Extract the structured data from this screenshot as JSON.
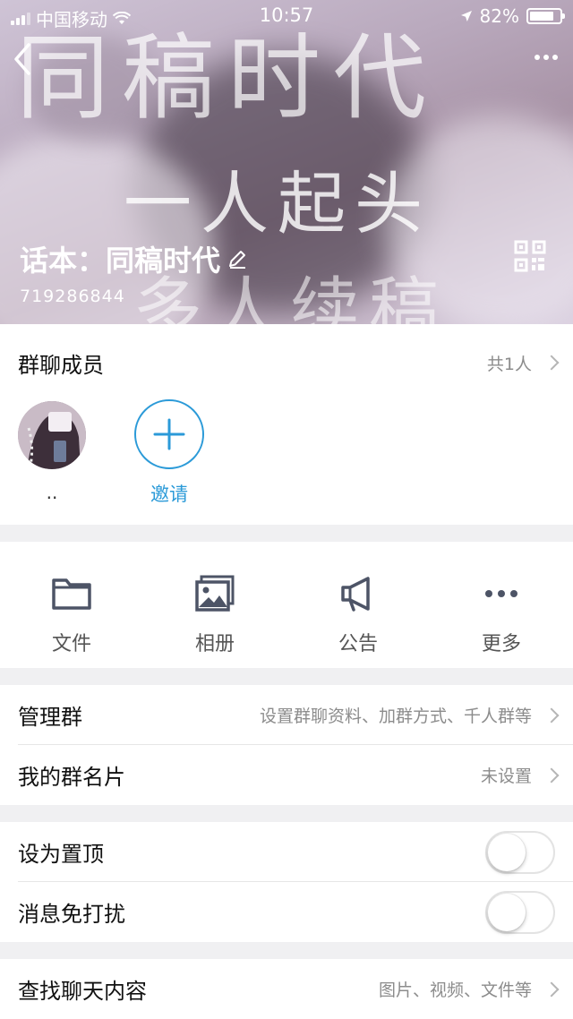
{
  "status_bar": {
    "carrier": "中国移动",
    "time": "10:57",
    "battery": "82%",
    "battery_level": 0.82
  },
  "header": {
    "overlay_line1": "同稿时代",
    "overlay_line2": "一人起头",
    "overlay_line3": "多人续稿",
    "group_name": "话本：同稿时代",
    "group_id": "719286844",
    "icons": {
      "back": "back-chevron-icon",
      "more": "more-dots-icon",
      "edit": "pencil-icon",
      "qr": "qr-code-icon"
    }
  },
  "members": {
    "title": "群聊成员",
    "count": "共1人",
    "list": [
      {
        "name": ".."
      }
    ],
    "invite_label": "邀请"
  },
  "tools": [
    {
      "label": "文件",
      "icon": "folder-icon"
    },
    {
      "label": "相册",
      "icon": "photo-album-icon"
    },
    {
      "label": "公告",
      "icon": "megaphone-icon"
    },
    {
      "label": "更多",
      "icon": "more-dots-icon"
    }
  ],
  "manage": {
    "label": "管理群",
    "value": "设置群聊资料、加群方式、千人群等"
  },
  "card": {
    "label": "我的群名片",
    "value": "未设置"
  },
  "settings": {
    "pin": {
      "label": "设为置顶",
      "on": false
    },
    "mute": {
      "label": "消息免打扰",
      "on": false
    }
  },
  "search": {
    "label": "查找聊天内容",
    "value": "图片、视频、文件等"
  }
}
